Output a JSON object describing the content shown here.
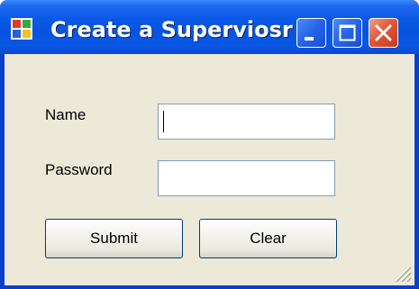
{
  "window": {
    "title": "Create a Superviosr",
    "icon": "windows-app-icon",
    "controls": [
      "minimize-icon",
      "maximize-icon",
      "close-icon"
    ]
  },
  "form": {
    "name_label": "Name",
    "name_value": "",
    "password_label": "Password",
    "password_value": ""
  },
  "buttons": {
    "submit_label": "Submit",
    "clear_label": "Clear"
  },
  "colors": {
    "titlebar": "#0854e0",
    "client": "#ece9d8",
    "close_button": "#e3583a"
  }
}
